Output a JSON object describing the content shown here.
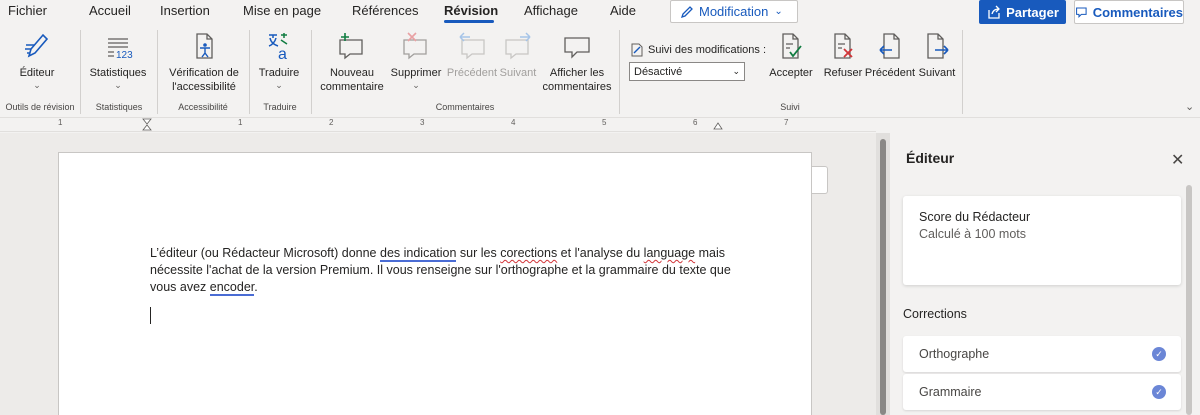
{
  "tabs": [
    {
      "label": "Fichier"
    },
    {
      "label": "Accueil"
    },
    {
      "label": "Insertion"
    },
    {
      "label": "Mise en page"
    },
    {
      "label": "Références"
    },
    {
      "label": "Révision"
    },
    {
      "label": "Affichage"
    },
    {
      "label": "Aide"
    }
  ],
  "active_tab": "Révision",
  "mode_button": {
    "label": "Modification",
    "icon": "pencil-icon"
  },
  "share_button": {
    "label": "Partager",
    "icon": "share-icon"
  },
  "comments_button": {
    "label": "Commentaires",
    "icon": "comment-icon"
  },
  "ribbon": {
    "editor": {
      "label": "Éditeur",
      "group": "Outils de révision"
    },
    "stats": {
      "label": "Statistiques",
      "group": "Statistiques",
      "icon_text": "123"
    },
    "access": {
      "label1": "Vérification de",
      "label2": "l'accessibilité",
      "group": "Accessibilité"
    },
    "translate": {
      "label": "Traduire",
      "group": "Traduire"
    },
    "comments": {
      "group": "Commentaires",
      "new1": "Nouveau",
      "new2": "commentaire",
      "delete": "Supprimer",
      "prev": "Précédent",
      "next": "Suivant",
      "show1": "Afficher les",
      "show2": "commentaires"
    },
    "tracking": {
      "group": "Suivi",
      "label": "Suivi des modifications :",
      "value": "Désactivé",
      "accept": "Accepter",
      "reject": "Refuser",
      "prev": "Précédent",
      "next": "Suivant"
    }
  },
  "ruler": {
    "numbers": [
      "1",
      "1",
      "2",
      "3",
      "4",
      "5",
      "6",
      "7"
    ]
  },
  "document": {
    "p1": "L’éditeur (ou Rédacteur Microsoft) donne ",
    "e1": "des indication",
    "p2": " sur les ",
    "e2": "corections",
    "p3": " et l'analyse du ",
    "e3": "language",
    "p4": " mais nécessite l'achat de la version Premium. Il vous renseigne sur l'orthographe et la grammaire du texte que vous avez ",
    "e4": "encoder",
    "p5": "."
  },
  "editor_pane": {
    "title": "Éditeur",
    "close_icon": "close-icon",
    "score_title": "Score du Rédacteur",
    "score_sub": "Calculé à 100 mots",
    "corrections_title": "Corrections",
    "corrections": [
      {
        "label": "Orthographe"
      },
      {
        "label": "Grammaire"
      }
    ]
  },
  "colors": {
    "accent": "#185abd",
    "check": "#6b86d6",
    "spelling_error": "#d13438",
    "grammar_error": "#4a6cd4"
  }
}
